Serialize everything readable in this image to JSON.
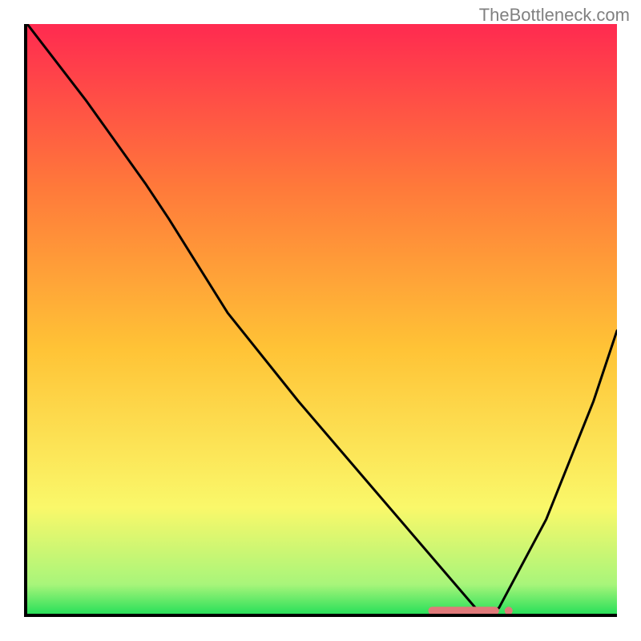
{
  "watermark": "TheBottleneck.com",
  "chart_data": {
    "type": "line",
    "title": "",
    "xlabel": "",
    "ylabel": "",
    "x_range": [
      0,
      100
    ],
    "y_range": [
      0,
      100
    ],
    "background_gradient": {
      "top": "#ff2a50",
      "upper_mid": "#ff7a3a",
      "mid": "#ffc336",
      "lower_mid": "#faf86a",
      "near_bottom": "#a8f57a",
      "bottom": "#2ae05a"
    },
    "series": [
      {
        "name": "curve",
        "x": [
          0,
          10,
          20,
          24,
          34,
          46,
          58,
          70,
          76,
          78,
          80,
          88,
          96,
          100
        ],
        "y": [
          100,
          87,
          73,
          67,
          51,
          36,
          22,
          8,
          1,
          0,
          1,
          16,
          36,
          48
        ]
      }
    ],
    "marker_region": {
      "x_start": 68,
      "x_end": 80,
      "y": 0.5,
      "color": "#e07a7a"
    }
  }
}
